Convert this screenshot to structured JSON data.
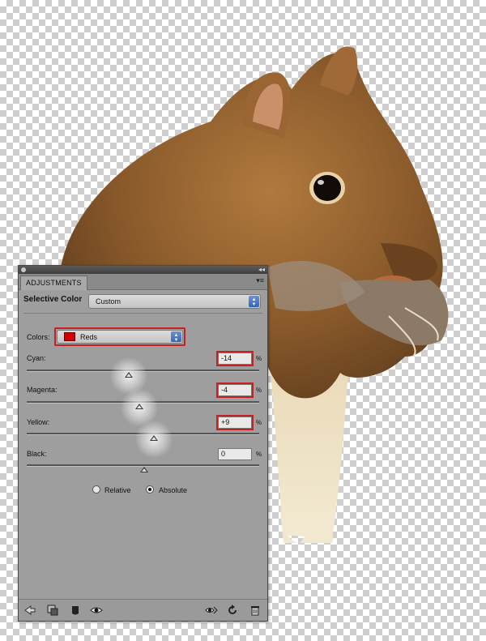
{
  "panel": {
    "tab_label": "ADJUSTMENTS",
    "heading": "Selective Color",
    "preset_value": "Custom",
    "colors_label": "Colors:",
    "colors_value": "Reds",
    "colors_swatch": "#d40000",
    "sliders": [
      {
        "label": "Cyan:",
        "value": "-14",
        "unit": "%",
        "position_pct": -14,
        "highlighted": true
      },
      {
        "label": "Magenta:",
        "value": "-4",
        "unit": "%",
        "position_pct": -4,
        "highlighted": true
      },
      {
        "label": "Yellow:",
        "value": "+9",
        "unit": "%",
        "position_pct": 9,
        "highlighted": true
      },
      {
        "label": "Black:",
        "value": "0",
        "unit": "%",
        "position_pct": 0,
        "highlighted": false
      }
    ],
    "method": {
      "relative_label": "Relative",
      "absolute_label": "Absolute",
      "selected": "Absolute"
    },
    "bottom_icons": [
      "back-arrow-icon",
      "clip-layer-icon",
      "visibility-mask-icon",
      "eye-icon",
      "view-previous-icon",
      "reset-icon",
      "trash-icon"
    ]
  },
  "colors": {
    "highlight": "#c62020",
    "panel_bg": "#9e9e9e"
  }
}
